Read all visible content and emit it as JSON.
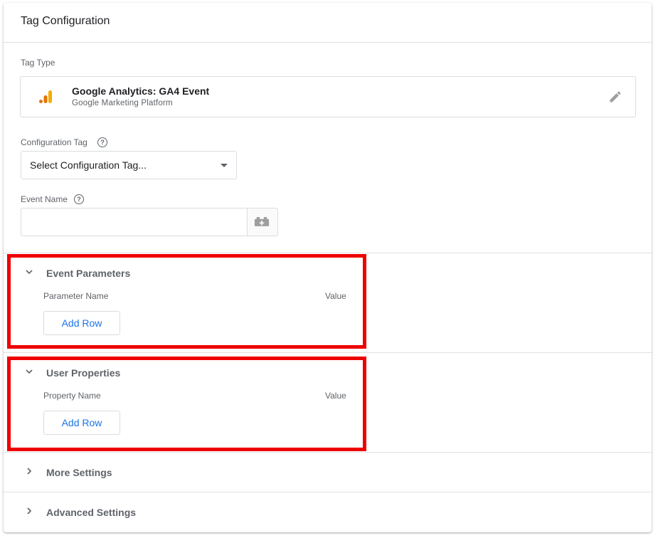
{
  "card": {
    "title": "Tag Configuration"
  },
  "tag_type": {
    "label": "Tag Type",
    "name": "Google Analytics: GA4 Event",
    "vendor": "Google Marketing Platform",
    "logo_icon": "google-analytics-logo",
    "edit_icon": "pencil-icon"
  },
  "configuration_tag": {
    "label": "Configuration Tag",
    "selected": "Select Configuration Tag..."
  },
  "event_name": {
    "label": "Event Name",
    "value": "",
    "variable_icon": "variable-picker-icon"
  },
  "event_parameters": {
    "title": "Event Parameters",
    "col_name": "Parameter Name",
    "col_value": "Value",
    "add_row": "Add Row"
  },
  "user_properties": {
    "title": "User Properties",
    "col_name": "Property Name",
    "col_value": "Value",
    "add_row": "Add Row"
  },
  "more_settings": {
    "title": "More Settings"
  },
  "advanced_settings": {
    "title": "Advanced Settings"
  },
  "colors": {
    "accent": "#1a73e8",
    "highlight": "#ee0000",
    "ga_orange": "#f9ab00",
    "ga_dark_orange": "#e37400"
  }
}
